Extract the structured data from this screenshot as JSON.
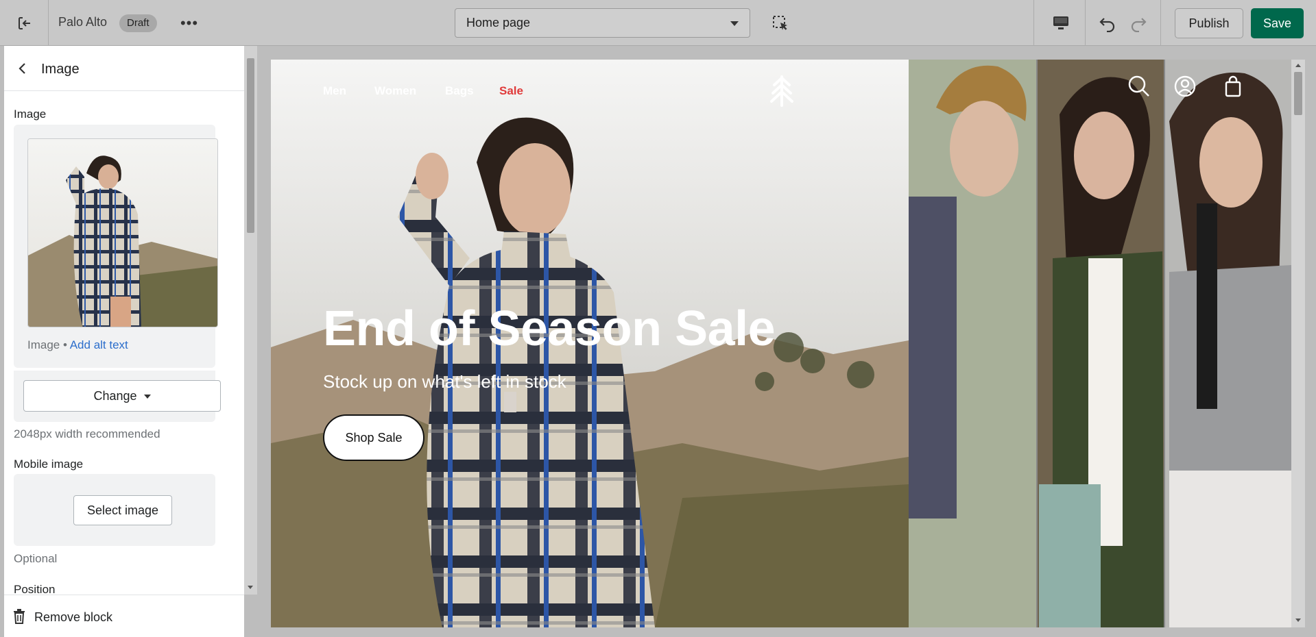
{
  "topbar": {
    "store_name": "Palo Alto",
    "status_badge": "Draft",
    "page_selector_value": "Home page",
    "publish_label": "Publish",
    "save_label": "Save",
    "icons": [
      "exit-icon",
      "more-icon",
      "inspector-icon",
      "desktop-icon",
      "undo-icon",
      "redo-icon"
    ]
  },
  "panel": {
    "title": "Image",
    "image_label": "Image",
    "image_meta_type": "Image",
    "image_meta_sep": " • ",
    "add_alt_text": "Add alt text",
    "change_label": "Change",
    "image_hint": "2048px width recommended",
    "mobile_image_label": "Mobile image",
    "select_image_label": "Select image",
    "mobile_hint": "Optional",
    "position_label": "Position",
    "remove_block_label": "Remove block"
  },
  "preview": {
    "nav": [
      {
        "label": "Men"
      },
      {
        "label": "Women"
      },
      {
        "label": "Bags"
      },
      {
        "label": "Sale"
      }
    ],
    "hero_title": "End of Season Sale",
    "hero_subtitle": "Stock up on what's left in stock",
    "cta_label": "Shop Sale"
  },
  "colors": {
    "save_bg": "#00684c",
    "link": "#2c6ecb",
    "sale_nav": "#e03a3a"
  }
}
